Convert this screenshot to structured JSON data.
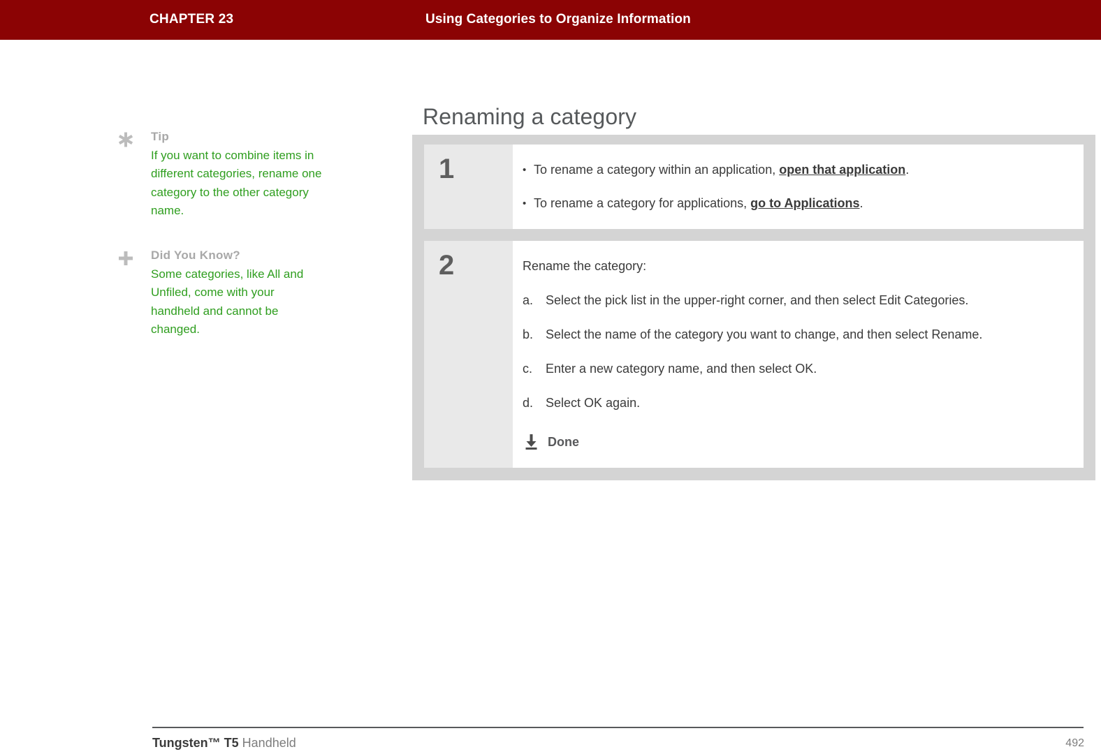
{
  "header": {
    "chapter": "CHAPTER 23",
    "title": "Using Categories to Organize Information",
    "background_color": "#8b0304",
    "text_color": "#ffffff"
  },
  "sidebar": {
    "notes": [
      {
        "icon": "asterisk-icon",
        "heading": "Tip",
        "text": "If you want to combine items in different categories, rename one category to the other category name."
      },
      {
        "icon": "plus-icon",
        "heading": "Did You Know?",
        "text": "Some categories, like All and Unfiled, come with your handheld and cannot be changed."
      }
    ],
    "heading_color": "#a8a8a8",
    "text_color": "#2f9e1f"
  },
  "main": {
    "page_title": "Renaming a category",
    "steps": [
      {
        "number": "1",
        "bullets": [
          {
            "prefix": "To rename a category within an application, ",
            "link": "open that application",
            "suffix": "."
          },
          {
            "prefix": "To rename a category for applications, ",
            "link": "go to Applications",
            "suffix": "."
          }
        ]
      },
      {
        "number": "2",
        "intro": "Rename the category:",
        "substeps": [
          {
            "marker": "a.",
            "text": "Select the pick list in the upper-right corner, and then select Edit Categories."
          },
          {
            "marker": "b.",
            "text": "Select the name of the category you want to change, and then select Rename."
          },
          {
            "marker": "c.",
            "text": "Enter a new category name, and then select OK."
          },
          {
            "marker": "d.",
            "text": "Select OK again."
          }
        ],
        "done_label": "Done",
        "done_icon": "download-arrow-icon"
      }
    ]
  },
  "footer": {
    "brand": "Tungsten™ T5",
    "product": " Handheld",
    "page_number": "492"
  }
}
